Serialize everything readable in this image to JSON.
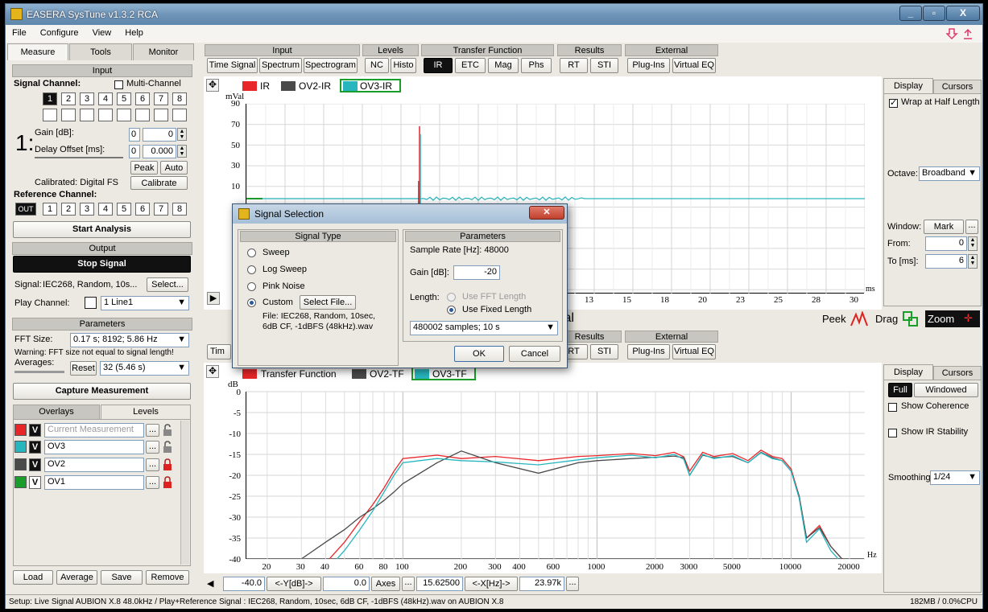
{
  "window": {
    "title": "EASERA SysTune v1.3.2 RCA",
    "min": "_",
    "max": "▫",
    "close": "X"
  },
  "menu": [
    "File",
    "Configure",
    "View",
    "Help"
  ],
  "left": {
    "tabs": [
      "Measure",
      "Tools",
      "Monitor"
    ],
    "input_header": "Input",
    "signal_channel": "Signal Channel:",
    "multi_channel": "Multi-Channel",
    "channels": [
      "1",
      "2",
      "3",
      "4",
      "5",
      "6",
      "7",
      "8"
    ],
    "big_num": "1:",
    "gain_label": "Gain [dB]:",
    "gain_box": "0",
    "gain_value": "0",
    "delay_label": "Delay Offset [ms]:",
    "delay_box": "0",
    "delay_value": "0.000",
    "peak": "Peak",
    "auto": "Auto",
    "calibrated": "Calibrated: Digital FS",
    "calibrate": "Calibrate",
    "reference_channel": "Reference Channel:",
    "ref_out": "OUT",
    "start_analysis": "Start Analysis",
    "output_header": "Output",
    "stop_signal": "Stop Signal",
    "signal_label": "Signal:",
    "signal_value": "IEC268, Random, 10s...",
    "select": "Select...",
    "play_channel": "Play Channel:",
    "play_value": "1 Line1",
    "parameters_header": "Parameters",
    "fft_label": "FFT Size:",
    "fft_value": "0.17 s; 8192; 5.86 Hz",
    "warning": "Warning: FFT size not equal to signal length!",
    "averages": "Averages:",
    "reset": "Reset",
    "avg_value": "32 (5.46 s)",
    "capture": "Capture Measurement",
    "overlay_tabs": [
      "Overlays",
      "Levels"
    ],
    "overlays": [
      {
        "color": "#e8262a",
        "name": "Current Measurement",
        "lock": "open"
      },
      {
        "color": "#27b6be",
        "name": "OV3",
        "lock": "open"
      },
      {
        "color": "#4a4a4a",
        "name": "OV2",
        "lock": "red"
      },
      {
        "color": "#1b9d2c",
        "name": "OV1",
        "lock": "red"
      }
    ],
    "v": "V",
    "dots": "...",
    "bottom_buttons": [
      "Load",
      "Average",
      "Save",
      "Remove"
    ]
  },
  "toolbar": {
    "groups": [
      {
        "title": "Input",
        "buttons": [
          "Time Signal",
          "Spectrum",
          "Spectrogram"
        ]
      },
      {
        "title": "Levels",
        "buttons": [
          "NC",
          "Histo"
        ]
      },
      {
        "title": "Transfer Function",
        "buttons": [
          "IR",
          "ETC",
          "Mag",
          "Phs"
        ]
      },
      {
        "title": "Results",
        "buttons": [
          "RT",
          "STI"
        ]
      },
      {
        "title": "External",
        "buttons": [
          "Plug-Ins",
          "Virtual EQ"
        ]
      }
    ],
    "lower_results": [
      "RT",
      "STI"
    ],
    "lower_external": [
      "Plug-Ins",
      "Virtual EQ"
    ],
    "lower_first": "Tim"
  },
  "top_graph": {
    "legend": [
      {
        "name": "IR",
        "color": "#e8262a"
      },
      {
        "name": "OV2-IR",
        "color": "#4a4a4a"
      },
      {
        "name": "OV3-IR",
        "color": "#27b6be"
      }
    ],
    "unit": "mVal",
    "x_unit": "ms",
    "yticks": [
      "90",
      "70",
      "50",
      "30",
      "10"
    ],
    "xticks": [
      "13",
      "15",
      "18",
      "20",
      "23",
      "25",
      "28",
      "30"
    ],
    "readout_partial": "Val",
    "peek": "Peek",
    "drag": "Drag",
    "zoom": "Zoom"
  },
  "chart_data": {
    "type": "line",
    "title": "",
    "xlabel": "Hz",
    "ylabel": "dB",
    "xscale": "log",
    "xlim": [
      15.625,
      23970
    ],
    "ylim": [
      -40,
      0
    ],
    "yticks": [
      0,
      -5,
      -10,
      -15,
      -20,
      -25,
      -30,
      -35,
      -40
    ],
    "xticks": [
      20,
      30,
      40,
      60,
      80,
      100,
      200,
      300,
      400,
      600,
      1000,
      2000,
      3000,
      5000,
      10000,
      20000
    ],
    "legend": [
      {
        "name": "Transfer Function",
        "color": "#e8262a"
      },
      {
        "name": "OV2-TF",
        "color": "#4a4a4a"
      },
      {
        "name": "OV3-TF",
        "color": "#27b6be"
      }
    ],
    "x": [
      30,
      40,
      50,
      60,
      70,
      80,
      90,
      100,
      150,
      200,
      300,
      500,
      800,
      1000,
      1500,
      2000,
      2500,
      2800,
      3000,
      3500,
      4000,
      5000,
      6000,
      7000,
      8000,
      9000,
      10000,
      11000,
      12000,
      14000,
      16000,
      20000
    ],
    "series": [
      {
        "name": "Transfer Function",
        "color": "#e8262a",
        "values": [
          -45,
          -41,
          -36,
          -31,
          -27,
          -23,
          -19,
          -16,
          -15.2,
          -16,
          -15.5,
          -16.5,
          -15.5,
          -15.3,
          -14.8,
          -15.3,
          -14.5,
          -15.6,
          -19,
          -14.5,
          -15.5,
          -14.8,
          -16.5,
          -14.0,
          -15.5,
          -16,
          -18.5,
          -25,
          -35,
          -32,
          -37,
          -42
        ]
      },
      {
        "name": "OV2-TF",
        "color": "#4a4a4a",
        "values": [
          -40,
          -36,
          -33,
          -30,
          -28,
          -26,
          -24,
          -22,
          -17,
          -14.2,
          -17,
          -19.5,
          -17,
          -16.5,
          -16,
          -15.7,
          -15.4,
          -15.8,
          -20,
          -15.2,
          -15.8,
          -15.5,
          -17,
          -14.5,
          -15.8,
          -16.5,
          -19,
          -25,
          -35,
          -32.5,
          -37,
          -42
        ]
      },
      {
        "name": "OV3-TF",
        "color": "#27b6be",
        "values": [
          -47,
          -43,
          -38,
          -33,
          -28.5,
          -24,
          -20,
          -17,
          -16,
          -16.5,
          -16.8,
          -17.5,
          -16.3,
          -15.8,
          -15.2,
          -15.8,
          -15.0,
          -16.2,
          -20,
          -15.0,
          -16,
          -15.3,
          -17,
          -14.6,
          -16,
          -16.5,
          -19,
          -25.5,
          -36,
          -32.8,
          -38,
          -43
        ]
      }
    ]
  },
  "bottom_graph": {
    "readouts": [
      "-40.0",
      "<-Y[dB]->",
      "0.0",
      "Axes",
      "...",
      "15.62500",
      "<-X[Hz]->",
      "23.97k",
      "..."
    ]
  },
  "right_top": {
    "tabs": [
      "Display",
      "Cursors"
    ],
    "wrap": "Wrap at Half Length",
    "octave_label": "Octave:",
    "octave_value": "Broadband",
    "window_label": "Window:",
    "mark": "Mark",
    "from_label": "From:",
    "from_value": "0",
    "to_label": "To [ms]:",
    "to_value": "6"
  },
  "right_bottom": {
    "tabs": [
      "Display",
      "Cursors"
    ],
    "full": "Full",
    "windowed": "Windowed",
    "coherence": "Show Coherence",
    "ir_stability": "Show IR Stability",
    "smoothing_label": "Smoothing:",
    "smoothing_value": "1/24"
  },
  "dialog": {
    "title": "Signal Selection",
    "signal_type": "Signal Type",
    "parameters": "Parameters",
    "options": [
      "Sweep",
      "Log Sweep",
      "Pink Noise",
      "Custom"
    ],
    "select_file": "Select File...",
    "file_text": "File: IEC268, Random, 10sec, 6dB CF, -1dBFS (48kHz).wav",
    "sample_rate": "Sample Rate [Hz]: 48000",
    "gain_label": "Gain [dB]:",
    "gain_value": "-20",
    "length_label": "Length:",
    "use_fft": "Use FFT Length",
    "use_fixed": "Use Fixed Length",
    "samples_value": "480002 samples; 10 s",
    "ok": "OK",
    "cancel": "Cancel"
  },
  "status": {
    "left": "Setup: Live Signal AUBION X.8 48.0kHz / Play+Reference Signal : IEC268, Random, 10sec, 6dB CF, -1dBFS (48kHz).wav on AUBION X.8",
    "right": "182MB / 0.0%CPU"
  }
}
